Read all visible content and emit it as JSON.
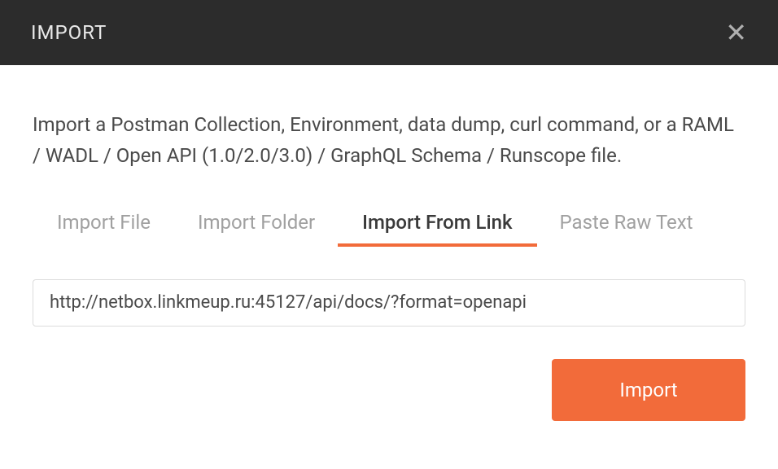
{
  "header": {
    "title": "IMPORT"
  },
  "description": "Import a Postman Collection, Environment, data dump, curl command, or a RAML / WADL / Open API (1.0/2.0/3.0) / GraphQL Schema / Runscope file.",
  "tabs": {
    "items": [
      {
        "label": "Import File"
      },
      {
        "label": "Import Folder"
      },
      {
        "label": "Import From Link"
      },
      {
        "label": "Paste Raw Text"
      }
    ]
  },
  "form": {
    "url_value": "http://netbox.linkmeup.ru:45127/api/docs/?format=openapi",
    "import_button_label": "Import"
  }
}
